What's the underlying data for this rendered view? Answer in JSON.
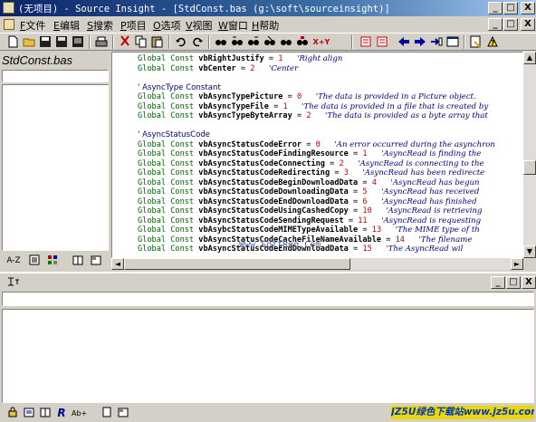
{
  "window": {
    "title": "(无项目) - Source Insight - [StdConst.bas (g:\\soft\\sourceinsight)]",
    "minimize": "_",
    "restore": "□",
    "close": "X"
  },
  "menu": [
    {
      "key": "F",
      "label": "文件"
    },
    {
      "key": "E",
      "label": "编辑"
    },
    {
      "key": "S",
      "label": "搜索"
    },
    {
      "key": "P",
      "label": "项目"
    },
    {
      "key": "O",
      "label": "选项"
    },
    {
      "key": "V",
      "label": "视图"
    },
    {
      "key": "W",
      "label": "窗口"
    },
    {
      "key": "H",
      "label": "帮助"
    }
  ],
  "mdi": {
    "minimize": "_",
    "restore": "□",
    "close": "X"
  },
  "toolbar": {
    "icons": [
      "new-file-icon",
      "open-folder-icon",
      "save-icon",
      "save-all-icon",
      "close-file-icon",
      "print-icon",
      "cut-icon",
      "copy-icon",
      "paste-icon",
      "undo-icon",
      "redo-icon",
      "find-icon",
      "find-prev-icon",
      "find-next-icon",
      "replace-icon",
      "lookup-icon",
      "find-symbol-icon",
      "bookmark-prev-icon",
      "bookmark-next-icon",
      "go-back-icon",
      "go-forward-icon",
      "jump-icon",
      "window-icon",
      "browse-icon",
      "help-icon"
    ],
    "xy_label": "X+Y"
  },
  "symbol_panel": {
    "title": "StdConst.bas",
    "input_value": "",
    "sort_label": "A-Z"
  },
  "code": {
    "lines": [
      {
        "type": "decl",
        "kw": "Global Const",
        "name": "vbRightJustify",
        "op": "=",
        "val": "1",
        "comment": "'Right align"
      },
      {
        "type": "decl",
        "kw": "Global Const",
        "name": "vbCenter",
        "op": "=",
        "val": "2",
        "comment": "'Center"
      },
      {
        "type": "blank"
      },
      {
        "type": "section",
        "text": "' AsyncType Constant"
      },
      {
        "type": "decl",
        "kw": "Global Const",
        "name": "vbAsyncTypePicture",
        "op": "=",
        "val": "0",
        "comment": "'The data is provided in a Picture object."
      },
      {
        "type": "decl",
        "kw": "Global Const",
        "name": "vbAsyncTypeFile",
        "op": "=",
        "val": "1",
        "comment": "'The data is provided in a file that is created by"
      },
      {
        "type": "decl",
        "kw": "Global Const",
        "name": "vbAsyncTypeByteArray",
        "op": "=",
        "val": "2",
        "comment": "'The data is provided as a byte array that"
      },
      {
        "type": "blank"
      },
      {
        "type": "section",
        "text": "' AsyncStatusCode"
      },
      {
        "type": "decl",
        "kw": "Global Const",
        "name": "vbAsyncStatusCodeError",
        "op": "=",
        "val": "0",
        "comment": "'An error occurred during the asynchron"
      },
      {
        "type": "decl",
        "kw": "Global Const",
        "name": "vbAsyncStatusCodeFindingResource",
        "op": "=",
        "val": "1",
        "comment": "'AsyncRead is finding the"
      },
      {
        "type": "decl",
        "kw": "Global Const",
        "name": "vbAsyncStatusCodeConnecting",
        "op": "=",
        "val": "2",
        "comment": "'AsyncRead is connecting to the"
      },
      {
        "type": "decl",
        "kw": "Global Const",
        "name": "vbAsyncStatusCodeRedirecting",
        "op": "=",
        "val": "3",
        "comment": "'AsyncRead has been redirecte"
      },
      {
        "type": "decl",
        "kw": "Global Const",
        "name": "vbAsyncStatusCodeBeginDownloadData",
        "op": "=",
        "val": "4",
        "comment": "'AsyncRead has begun"
      },
      {
        "type": "decl",
        "kw": "Global Const",
        "name": "vbAsyncStatusCodeDownloadingData",
        "op": "=",
        "val": "5",
        "comment": "'AsyncRead has received"
      },
      {
        "type": "decl",
        "kw": "Global Const",
        "name": "vbAsyncStatusCodeEndDownloadData",
        "op": "=",
        "val": "6",
        "comment": "'AsyncRead has finished"
      },
      {
        "type": "decl",
        "kw": "Global Const",
        "name": "vbAsyncStatusCodeUsingCashedCopy",
        "op": "=",
        "val": "10",
        "comment": "'AsyncRead is retrieving"
      },
      {
        "type": "decl",
        "kw": "Global Const",
        "name": "vbAsyncStatusCodeSendingRequest",
        "op": "=",
        "val": "11",
        "comment": "'AsyncRead is requesting"
      },
      {
        "type": "decl",
        "kw": "Global Const",
        "name": "vbAsybcStatusCodeMIMETypeAvailable",
        "op": "=",
        "val": "13",
        "comment": "'The MIME type of th"
      },
      {
        "type": "decl",
        "kw": "Global Const",
        "name": "vbAsyncStatusCodeCacheFileNameAvailable",
        "op": "=",
        "val": "14",
        "comment": "'The filename"
      },
      {
        "type": "decl",
        "kw": "Global Const",
        "name": "vbAsyncStatusCodeEndDownloadData",
        "op": "=",
        "val": "15",
        "comment": "'The AsyncRead wil"
      }
    ],
    "watermark": "Www.SoftReg.Com"
  },
  "context_panel": {
    "input_value": ""
  },
  "banner": "JZ5U绿色下载站www.jz5u.com",
  "colors": {
    "titlebar_start": "#0a246a",
    "keyword": "#006400",
    "number": "#c00000",
    "comment": "#000080",
    "banner_bg": "#e8d800"
  }
}
